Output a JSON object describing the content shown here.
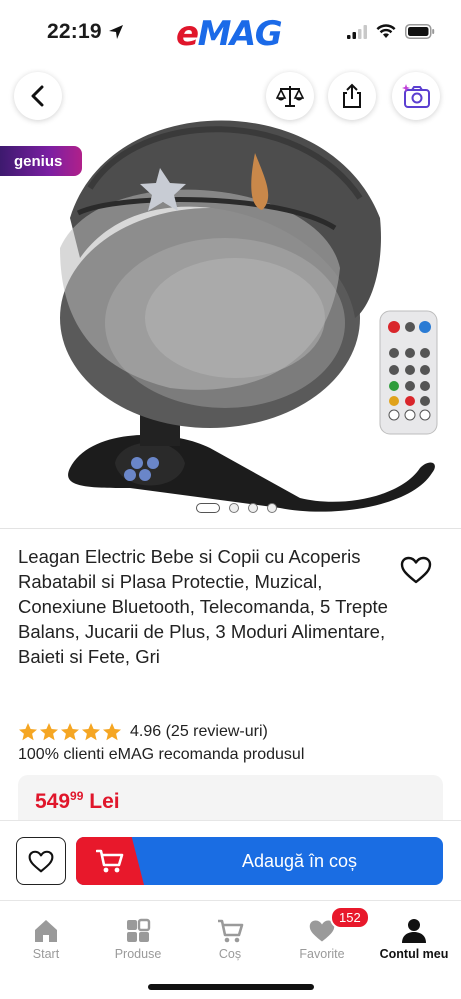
{
  "status_bar": {
    "time": "22:19",
    "logo_e": "e",
    "logo_mag": "MAG"
  },
  "gallery": {
    "genius_label": "genius",
    "image_count": 4,
    "active_image": 1
  },
  "product": {
    "title": "Leagan Electric Bebe si Copii cu Acoperis Rabatabil si Plasa Protectie, Muzical, Conexiune Bluetooth, Telecomanda, 5 Trepte Balans, Jucarii de Plus, 3 Moduri Alimentare, Baieti si Fete, Gri",
    "rating": "4.96",
    "review_count": "(25 review-uri)",
    "stars": 5,
    "recommend": "100% clienti eMAG recomanda produsul",
    "price_main": "549",
    "price_cents": "99",
    "price_currency": "Lei"
  },
  "buy_bar": {
    "add_to_cart_label": "Adaugă în coș"
  },
  "tab_bar": {
    "items": [
      {
        "label": "Start",
        "icon": "home-icon"
      },
      {
        "label": "Produse",
        "icon": "grid-icon"
      },
      {
        "label": "Coș",
        "icon": "cart-icon"
      },
      {
        "label": "Favorite",
        "icon": "heart-icon"
      },
      {
        "label": "Contul meu",
        "icon": "user-icon"
      }
    ],
    "favorites_badge": "152"
  },
  "colors": {
    "brand_red": "#e0162b",
    "brand_blue": "#1b6ae8",
    "star": "#f5a623"
  }
}
